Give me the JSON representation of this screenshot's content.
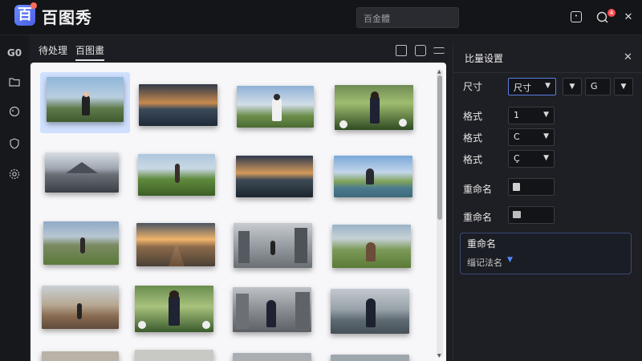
{
  "app": {
    "logo_char": "百",
    "title": "百图秀"
  },
  "search": {
    "placeholder": "百金體"
  },
  "titlebar": {
    "notification_count": "4"
  },
  "rail": {
    "items": [
      "G0",
      "folder",
      "paint",
      "badge",
      "settings"
    ]
  },
  "subbar": {
    "tabs": [
      "待处理",
      "百图畫"
    ]
  },
  "settings": {
    "title": "比量设置",
    "rows": [
      {
        "label": "尺寸",
        "value": "尺寸"
      },
      {
        "label": "格式",
        "value": "1"
      },
      {
        "label": "格式",
        "value": "C"
      },
      {
        "label": "格式",
        "value": "Ç"
      },
      {
        "label": "重命名"
      },
      {
        "label": "重命名"
      }
    ],
    "size_extra_value": "G",
    "rename_box": {
      "title": "重命名",
      "value": "缁记法名"
    }
  },
  "thumbnails": [
    "woman-sitting-grass-mountains",
    "lake-city-sunset",
    "woman-field-clouds",
    "woman-garden-flowers",
    "mountain-lake-clouds",
    "woman-road-mountains",
    "lake-city-dusk",
    "woman-lakeside",
    "woman-meadow-hills",
    "road-sunset",
    "man-city-walkway",
    "woman-alpine-meadow",
    "woman-canyon-road",
    "woman-garden-balls",
    "woman-city-street",
    "woman-riverside-bridge",
    "row5-a",
    "row5-b",
    "row5-c",
    "row5-d"
  ],
  "colors": {
    "accent": "#5b7ee5",
    "selection": "#8fb2ff",
    "panel": "#1e1f24"
  }
}
